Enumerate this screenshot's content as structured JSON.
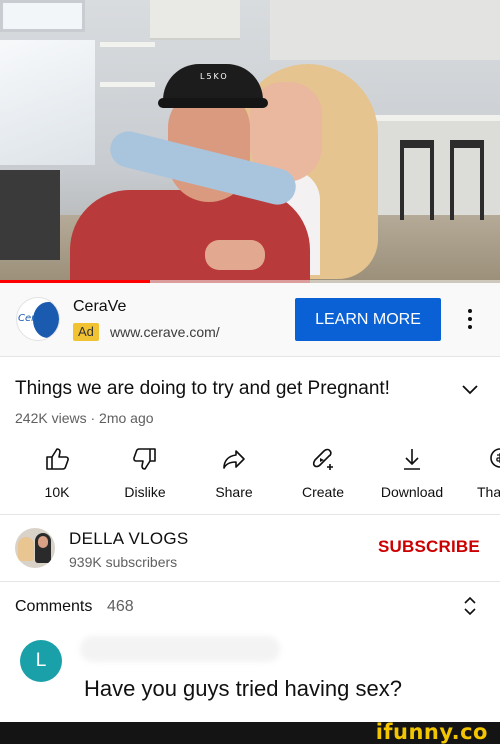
{
  "video": {
    "cap_logo": "L5KO",
    "progress": 0.3,
    "progress_color": "#ff0000"
  },
  "ad": {
    "advertiser": "CeraVe",
    "logo_text": "CeraVe",
    "badge": "Ad",
    "url": "www.cerave.com/",
    "cta_label": "LEARN MORE",
    "cta_color": "#0a61d6",
    "more_icon": "more-vert-icon"
  },
  "video_info": {
    "title": "Things we are doing to try and get Pregnant!",
    "meta": "242K views · 2mo ago",
    "expand_icon": "chevron-down-icon"
  },
  "actions": [
    {
      "icon": "thumbs-up-icon",
      "label": "10K"
    },
    {
      "icon": "thumbs-down-icon",
      "label": "Dislike"
    },
    {
      "icon": "share-icon",
      "label": "Share"
    },
    {
      "icon": "create-icon",
      "label": "Create"
    },
    {
      "icon": "download-icon",
      "label": "Download"
    },
    {
      "icon": "thanks-icon",
      "label": "Tha"
    }
  ],
  "channel": {
    "name": "DELLA VLOGS",
    "subscribers": "939K subscribers",
    "subscribe_label": "SUBSCRIBE",
    "subscribe_color": "#cc0000"
  },
  "comments": {
    "label": "Comments",
    "count": "468",
    "expand_icon": "unfold-icon",
    "top_comment": {
      "avatar_letter": "L",
      "avatar_color": "#1aa0a8",
      "text": "Have you guys tried having sex?"
    }
  },
  "watermark": "ifunny.co"
}
